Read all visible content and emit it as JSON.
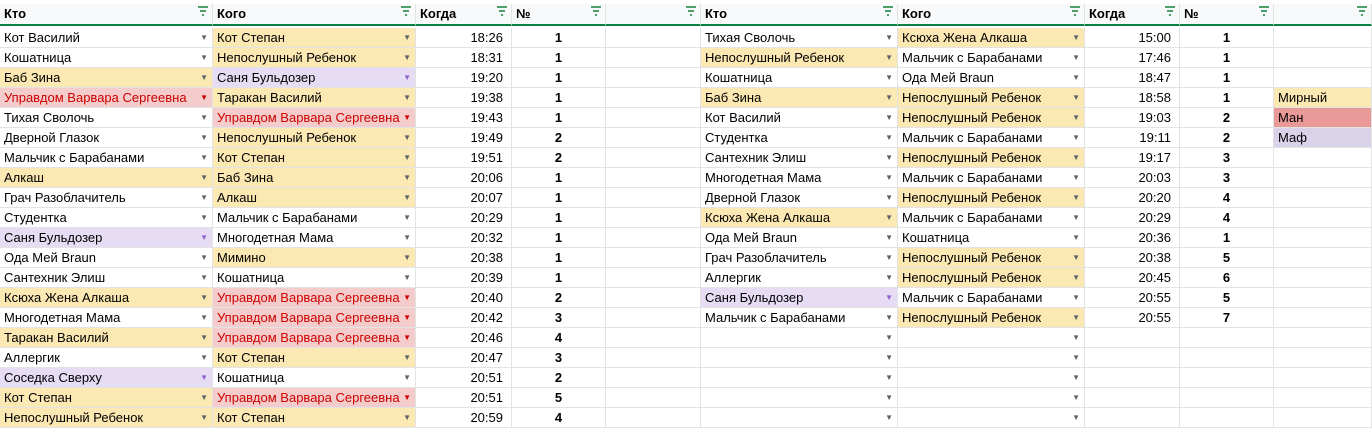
{
  "headers": {
    "who": "Кто",
    "whom": "Кого",
    "when": "Когда",
    "num": "№"
  },
  "icons": {
    "filter": "filter-icon",
    "dropdown": "chevron-down-icon"
  },
  "colors": {
    "yellow": "#fce8b2",
    "purple": "#e6dcf3",
    "red": "#f4cccc",
    "red_text": "#cc0000",
    "header_border": "#0b8043"
  },
  "left_table": [
    {
      "who": "Кот Василий",
      "who_c": "",
      "whom": "Кот Степан",
      "whom_c": "y",
      "when": "18:26",
      "num": "1"
    },
    {
      "who": "Кошатница",
      "who_c": "",
      "whom": "Непослушный Ребенок",
      "whom_c": "y",
      "when": "18:31",
      "num": "1"
    },
    {
      "who": "Баб Зина",
      "who_c": "y",
      "whom": "Саня Бульдозер",
      "whom_c": "p",
      "when": "19:20",
      "num": "1"
    },
    {
      "who": "Управдом Варвара Сергеевна",
      "who_c": "r",
      "whom": "Таракан Василий",
      "whom_c": "y",
      "when": "19:38",
      "num": "1"
    },
    {
      "who": "Тихая Сволочь",
      "who_c": "",
      "whom": "Управдом Варвара Сергеевна",
      "whom_c": "r",
      "when": "19:43",
      "num": "1"
    },
    {
      "who": "Дверной Глазок",
      "who_c": "",
      "whom": "Непослушный Ребенок",
      "whom_c": "y",
      "when": "19:49",
      "num": "2"
    },
    {
      "who": "Мальчик с Барабанами",
      "who_c": "",
      "whom": "Кот Степан",
      "whom_c": "y",
      "when": "19:51",
      "num": "2"
    },
    {
      "who": "Алкаш",
      "who_c": "y",
      "whom": "Баб Зина",
      "whom_c": "y",
      "when": "20:06",
      "num": "1"
    },
    {
      "who": "Грач Разоблачитель",
      "who_c": "",
      "whom": "Алкаш",
      "whom_c": "y",
      "when": "20:07",
      "num": "1"
    },
    {
      "who": "Студентка",
      "who_c": "",
      "whom": "Мальчик с Барабанами",
      "whom_c": "",
      "when": "20:29",
      "num": "1"
    },
    {
      "who": "Саня Бульдозер",
      "who_c": "p",
      "whom": "Многодетная Мама",
      "whom_c": "",
      "when": "20:32",
      "num": "1"
    },
    {
      "who": "Ода Мей Braun",
      "who_c": "",
      "whom": "Мимино",
      "whom_c": "y",
      "when": "20:38",
      "num": "1"
    },
    {
      "who": "Сантехник Элиш",
      "who_c": "",
      "whom": "Кошатница",
      "whom_c": "",
      "when": "20:39",
      "num": "1"
    },
    {
      "who": "Ксюха Жена Алкаша",
      "who_c": "y",
      "whom": "Управдом Варвара Сергеевна",
      "whom_c": "r",
      "when": "20:40",
      "num": "2"
    },
    {
      "who": "Многодетная Мама",
      "who_c": "",
      "whom": "Управдом Варвара Сергеевна",
      "whom_c": "r",
      "when": "20:42",
      "num": "3"
    },
    {
      "who": "Таракан Василий",
      "who_c": "y",
      "whom": "Управдом Варвара Сергеевна",
      "whom_c": "r",
      "when": "20:46",
      "num": "4"
    },
    {
      "who": "Аллергик",
      "who_c": "",
      "whom": "Кот Степан",
      "whom_c": "y",
      "when": "20:47",
      "num": "3"
    },
    {
      "who": "Соседка Сверху",
      "who_c": "p",
      "whom": "Кошатница",
      "whom_c": "",
      "when": "20:51",
      "num": "2"
    },
    {
      "who": "Кот Степан",
      "who_c": "y",
      "whom": "Управдом Варвара Сергеевна",
      "whom_c": "r",
      "when": "20:51",
      "num": "5"
    },
    {
      "who": "Непослушный Ребенок",
      "who_c": "y",
      "whom": "Кот Степан",
      "whom_c": "y",
      "when": "20:59",
      "num": "4"
    }
  ],
  "right_table": [
    {
      "who": "Тихая Сволочь",
      "who_c": "",
      "whom": "Ксюха Жена Алкаша",
      "whom_c": "y",
      "when": "15:00",
      "num": "1"
    },
    {
      "who": "Непослушный Ребенок",
      "who_c": "y",
      "whom": "Мальчик с Барабанами",
      "whom_c": "",
      "when": "17:46",
      "num": "1"
    },
    {
      "who": "Кошатница",
      "who_c": "",
      "whom": "Ода Мей Braun",
      "whom_c": "",
      "when": "18:47",
      "num": "1"
    },
    {
      "who": "Баб Зина",
      "who_c": "y",
      "whom": "Непослушный Ребенок",
      "whom_c": "y",
      "when": "18:58",
      "num": "1"
    },
    {
      "who": "Кот Василий",
      "who_c": "",
      "whom": "Непослушный Ребенок",
      "whom_c": "y",
      "when": "19:03",
      "num": "2"
    },
    {
      "who": "Студентка",
      "who_c": "",
      "whom": "Мальчик с Барабанами",
      "whom_c": "",
      "when": "19:11",
      "num": "2"
    },
    {
      "who": "Сантехник Элиш",
      "who_c": "",
      "whom": "Непослушный Ребенок",
      "whom_c": "y",
      "when": "19:17",
      "num": "3"
    },
    {
      "who": "Многодетная Мама",
      "who_c": "",
      "whom": "Мальчик с Барабанами",
      "whom_c": "",
      "when": "20:03",
      "num": "3"
    },
    {
      "who": "Дверной Глазок",
      "who_c": "",
      "whom": "Непослушный Ребенок",
      "whom_c": "y",
      "when": "20:20",
      "num": "4"
    },
    {
      "who": "Ксюха Жена Алкаша",
      "who_c": "y",
      "whom": "Мальчик с Барабанами",
      "whom_c": "",
      "when": "20:29",
      "num": "4"
    },
    {
      "who": "Ода Мей Braun",
      "who_c": "",
      "whom": "Кошатница",
      "whom_c": "",
      "when": "20:36",
      "num": "1"
    },
    {
      "who": "Грач Разоблачитель",
      "who_c": "",
      "whom": "Непослушный Ребенок",
      "whom_c": "y",
      "when": "20:38",
      "num": "5"
    },
    {
      "who": "Аллергик",
      "who_c": "",
      "whom": "Непослушный Ребенок",
      "whom_c": "y",
      "when": "20:45",
      "num": "6"
    },
    {
      "who": "Саня Бульдозер",
      "who_c": "p",
      "whom": "Мальчик с Барабанами",
      "whom_c": "",
      "when": "20:55",
      "num": "5"
    },
    {
      "who": "Мальчик с Барабанами",
      "who_c": "",
      "whom": "Непослушный Ребенок",
      "whom_c": "y",
      "when": "20:55",
      "num": "7"
    },
    {
      "who": "",
      "who_c": "",
      "whom": "",
      "whom_c": "",
      "when": "",
      "num": ""
    },
    {
      "who": "",
      "who_c": "",
      "whom": "",
      "whom_c": "",
      "when": "",
      "num": ""
    },
    {
      "who": "",
      "who_c": "",
      "whom": "",
      "whom_c": "",
      "when": "",
      "num": ""
    },
    {
      "who": "",
      "who_c": "",
      "whom": "",
      "whom_c": "",
      "when": "",
      "num": ""
    },
    {
      "who": "",
      "who_c": "",
      "whom": "",
      "whom_c": "",
      "when": "",
      "num": ""
    }
  ],
  "legend": [
    {
      "label": "Мирный",
      "color": "y"
    },
    {
      "label": "Ман",
      "color": "r"
    },
    {
      "label": "Маф",
      "color": "p"
    }
  ]
}
